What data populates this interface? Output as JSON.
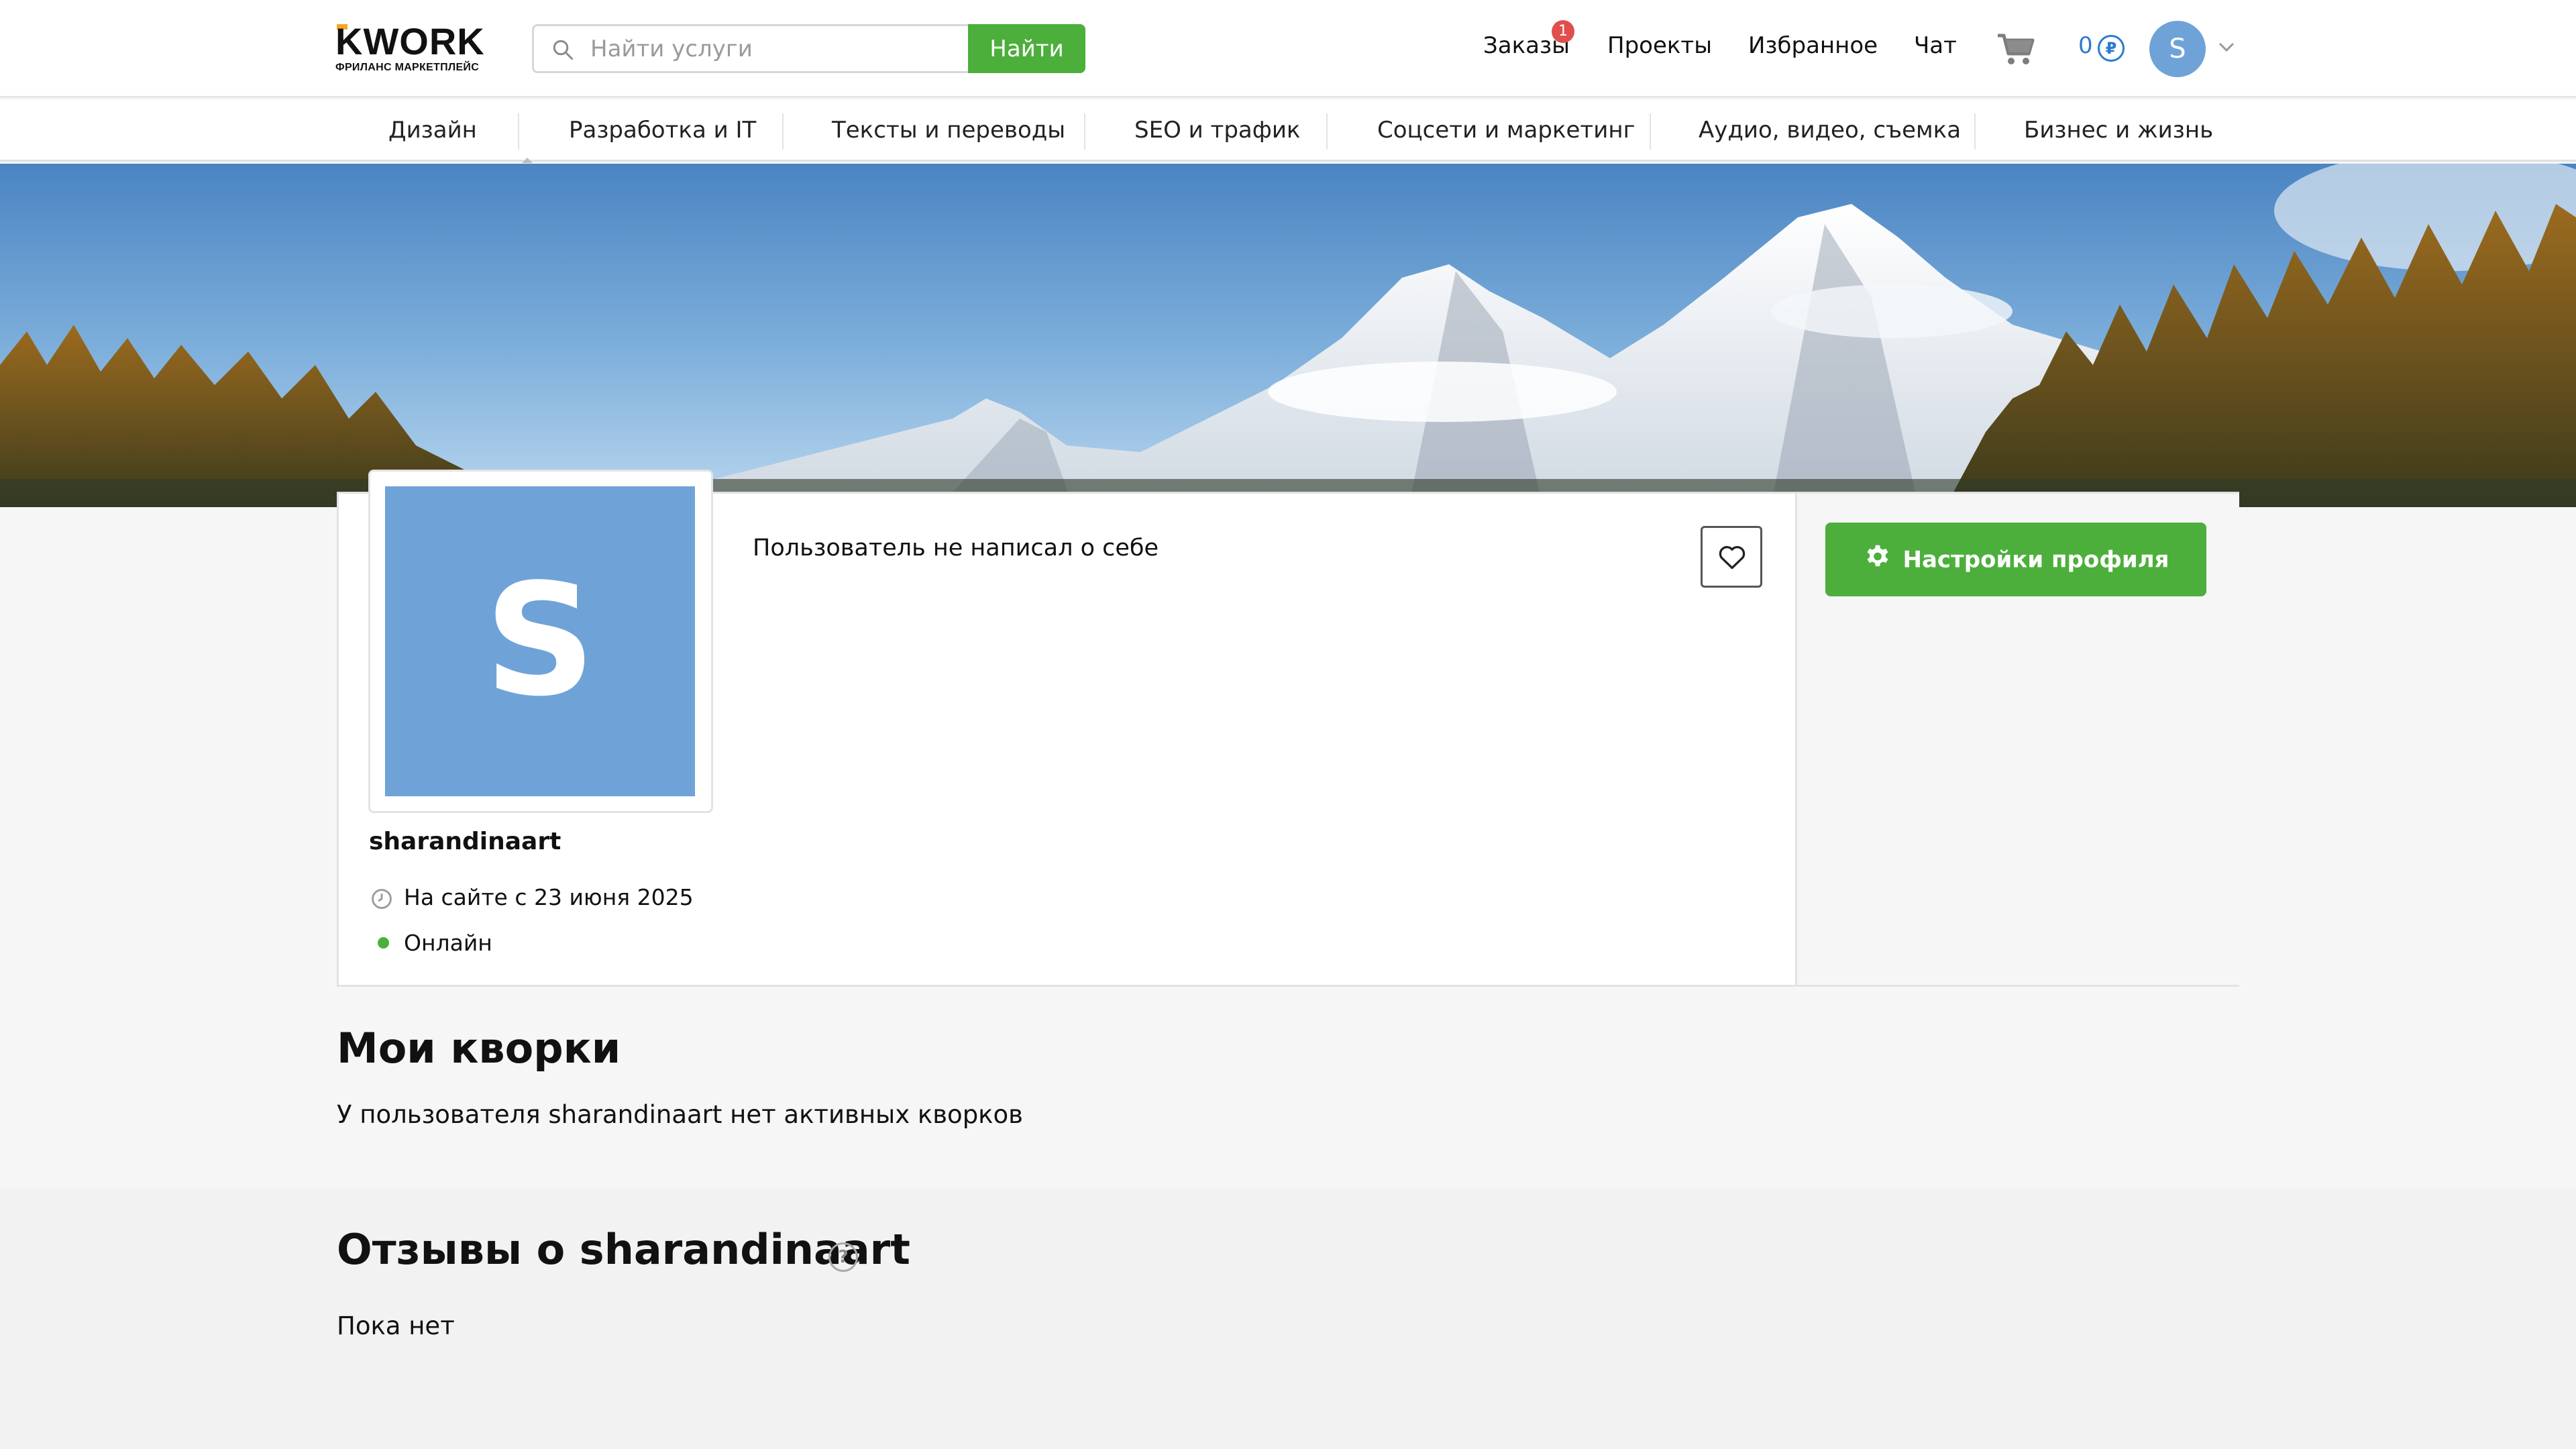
{
  "header": {
    "logo_text": "KWORK",
    "logo_subtitle": "ФРИЛАНС МАРКЕТПЛЕЙС",
    "search_placeholder": "Найти услуги",
    "search_button": "Найти",
    "nav": [
      {
        "label": "Заказы",
        "badge": "1"
      },
      {
        "label": "Проекты"
      },
      {
        "label": "Избранное"
      },
      {
        "label": "Чат"
      }
    ],
    "balance": "0",
    "currency_symbol": "₽",
    "avatar_letter": "S"
  },
  "categories": [
    "Дизайн",
    "Разработка и IT",
    "Тексты и переводы",
    "SEO и трафик",
    "Соцсети и маркетинг",
    "Аудио, видео, съемка",
    "Бизнес и жизнь"
  ],
  "profile": {
    "avatar_letter": "S",
    "username": "sharandinaart",
    "member_since": "На сайте с 23 июня 2025",
    "status": "Онлайн",
    "about": "Пользователь не написал о себе",
    "settings_button": "Настройки профиля"
  },
  "kworks": {
    "title": "Мои кворки",
    "empty_text": "У пользователя sharandinaart нет активных кворков"
  },
  "reviews": {
    "title": "Отзывы о sharandinaart",
    "help_symbol": "?",
    "empty_text": "Пока нет"
  },
  "colors": {
    "accent_green": "#4caf3b",
    "avatar_blue": "#6fa3d8",
    "badge_red": "#e04e4e",
    "balance_blue": "#2b7bd3"
  },
  "icons": [
    "search-icon",
    "cart-icon",
    "ruble-icon",
    "chevron-down-icon",
    "heart-icon",
    "gear-icon",
    "clock-icon",
    "help-icon"
  ]
}
